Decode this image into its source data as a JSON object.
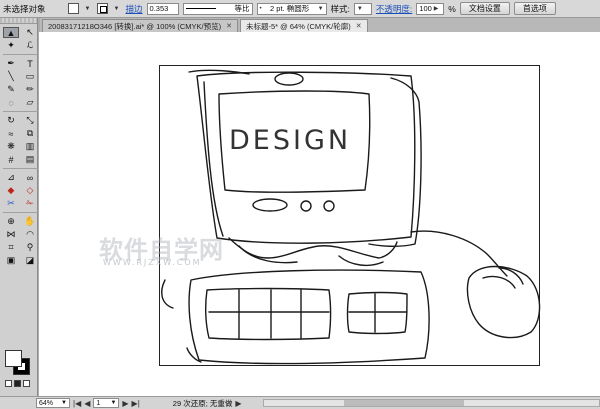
{
  "control_bar": {
    "selection_label": "未选择对象",
    "stroke_label": "描边",
    "stroke_weight": "0.353",
    "stroke_profile": "等比",
    "brush_label": "2 pt. 椭圆形",
    "style_label": "样式:",
    "opacity_label": "不透明度:",
    "opacity_value": "100",
    "percent": "%",
    "doc_setup_button": "文档设置",
    "preferences_button": "首选项"
  },
  "tabs": [
    {
      "label": "20083171218O346 [转换].ai* @ 100% (CMYK/预览)",
      "active": false
    },
    {
      "label": "未标题-5* @ 64% (CMYK/轮廓)",
      "active": true
    }
  ],
  "toolbox": {
    "tools": [
      {
        "icon": "selection-arrow-icon",
        "glyph": "▲",
        "selected": true
      },
      {
        "icon": "direct-selection-icon",
        "glyph": "↖"
      },
      {
        "icon": "magic-wand-icon",
        "glyph": "✦"
      },
      {
        "icon": "lasso-icon",
        "glyph": "ℒ"
      },
      {
        "icon": "pen-icon",
        "glyph": "✒"
      },
      {
        "icon": "type-icon",
        "glyph": "T"
      },
      {
        "icon": "line-icon",
        "glyph": "╲"
      },
      {
        "icon": "rectangle-icon",
        "glyph": "▭"
      },
      {
        "icon": "paintbrush-icon",
        "glyph": "✎"
      },
      {
        "icon": "pencil-icon",
        "glyph": "✏"
      },
      {
        "icon": "blob-brush-icon",
        "glyph": "◌"
      },
      {
        "icon": "eraser-icon",
        "glyph": "▱"
      },
      {
        "icon": "rotate-icon",
        "glyph": "↻"
      },
      {
        "icon": "scale-icon",
        "glyph": "⤡"
      },
      {
        "icon": "warp-icon",
        "glyph": "≈"
      },
      {
        "icon": "free-transform-icon",
        "glyph": "⧉"
      },
      {
        "icon": "symbol-sprayer-icon",
        "glyph": "❋"
      },
      {
        "icon": "column-graph-icon",
        "glyph": "▥"
      },
      {
        "icon": "mesh-icon",
        "glyph": "#"
      },
      {
        "icon": "gradient-icon",
        "glyph": "▤"
      },
      {
        "icon": "eyedropper-icon",
        "glyph": "⊿"
      },
      {
        "icon": "blend-icon",
        "glyph": "∞"
      },
      {
        "icon": "live-paint-bucket-icon",
        "glyph": "◆",
        "color": "red"
      },
      {
        "icon": "live-paint-select-icon",
        "glyph": "◇",
        "color": "red"
      },
      {
        "icon": "slice-icon",
        "glyph": "✂",
        "color": "blue"
      },
      {
        "icon": "scissors-icon",
        "glyph": "✁",
        "color": "red"
      },
      {
        "icon": "artboard-icon",
        "glyph": "⊕"
      },
      {
        "icon": "hand-icon",
        "glyph": "✋"
      },
      {
        "icon": "width-icon",
        "glyph": "⋈"
      },
      {
        "icon": "shape-builder-icon",
        "glyph": "◠"
      },
      {
        "icon": "perspective-grid-icon",
        "glyph": "⌗"
      },
      {
        "icon": "zoom-icon",
        "glyph": "⚲"
      },
      {
        "icon": "screen-mode-icon",
        "glyph": "▣"
      },
      {
        "icon": "draw-behind-icon",
        "glyph": "◪"
      }
    ]
  },
  "artwork": {
    "screen_text": "DESIGN"
  },
  "watermark": {
    "text": "软件自学网",
    "sub": "WWW.RJZXW.COM"
  },
  "status_bar": {
    "zoom": "64%",
    "artboard_number": "1",
    "message": "29 次还原; 无重做"
  }
}
